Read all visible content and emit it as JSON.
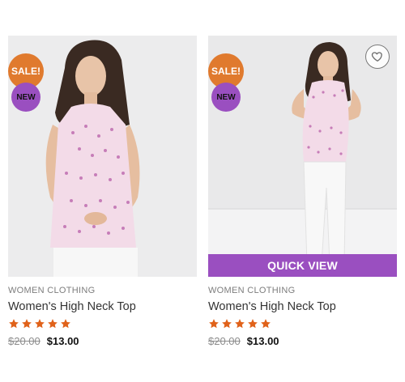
{
  "colors": {
    "sale_badge": "#E07A2E",
    "new_badge": "#9A4FC0",
    "quick_view": "#9A4FC0",
    "star": "#E0621A"
  },
  "products": [
    {
      "badge_sale": "SALE!",
      "badge_new": "NEW",
      "category": "WOMEN CLOTHING",
      "title": "Women's High Neck Top",
      "rating": 5,
      "old_price": "$20.00",
      "price": "$13.00"
    },
    {
      "badge_sale": "SALE!",
      "badge_new": "NEW",
      "category": "WOMEN CLOTHING",
      "title": "Women's High Neck Top",
      "rating": 5,
      "old_price": "$20.00",
      "price": "$13.00",
      "wishlist_icon": "heart-outline-icon",
      "quick_view_label": "QUICK VIEW"
    }
  ]
}
